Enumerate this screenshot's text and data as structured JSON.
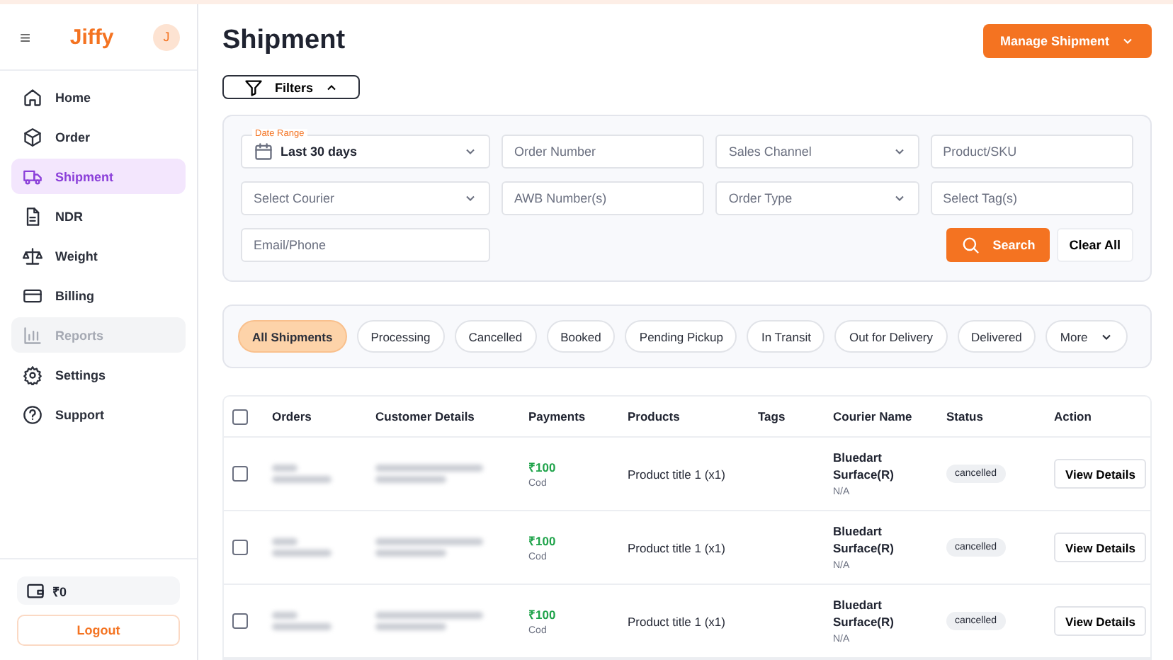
{
  "sidebar": {
    "menu_icon": "≡",
    "logo": "Jiffy",
    "avatar": "J",
    "items": [
      {
        "label": "Home",
        "selected": false,
        "disabled": false
      },
      {
        "label": "Order",
        "selected": false,
        "disabled": false
      },
      {
        "label": "Shipment",
        "selected": true,
        "disabled": false
      },
      {
        "label": "NDR",
        "selected": false,
        "disabled": false
      },
      {
        "label": "Weight",
        "selected": false,
        "disabled": false
      },
      {
        "label": "Billing",
        "selected": false,
        "disabled": false
      },
      {
        "label": "Reports",
        "selected": false,
        "disabled": true
      },
      {
        "label": "Settings",
        "selected": false,
        "disabled": false
      },
      {
        "label": "Support",
        "selected": false,
        "disabled": false
      }
    ],
    "wallet": "₹0",
    "logout": "Logout"
  },
  "page": {
    "title": "Shipment",
    "manage_button": "Manage Shipment",
    "filters_button": "Filters"
  },
  "filters": [
    {
      "kind": "date",
      "label": "Date Range",
      "value": "Last 30 days"
    },
    {
      "kind": "input",
      "placeholder": "Order Number"
    },
    {
      "kind": "select",
      "placeholder": "Sales Channel"
    },
    {
      "kind": "input",
      "placeholder": "Product/SKU"
    },
    {
      "kind": "select",
      "placeholder": "Select Courier"
    },
    {
      "kind": "input",
      "placeholder": "AWB Number(s)"
    },
    {
      "kind": "select",
      "placeholder": "Order Type"
    },
    {
      "kind": "input",
      "placeholder": "Select Tag(s)"
    },
    {
      "kind": "input",
      "placeholder": "Email/Phone"
    }
  ],
  "search_button": "Search",
  "clear_button": "Clear All",
  "status_tabs": [
    {
      "label": "All Shipments",
      "selected": true
    },
    {
      "label": "Processing",
      "selected": false
    },
    {
      "label": "Cancelled",
      "selected": false
    },
    {
      "label": "Booked",
      "selected": false
    },
    {
      "label": "Pending Pickup",
      "selected": false
    },
    {
      "label": "In Transit",
      "selected": false
    },
    {
      "label": "Out for Delivery",
      "selected": false
    },
    {
      "label": "Delivered",
      "selected": false
    },
    {
      "label": "More",
      "selected": false,
      "dropdown": true
    }
  ],
  "table": {
    "select_all_checked": false,
    "columns": [
      "Orders",
      "Customer Details",
      "Payments",
      "Products",
      "Tags",
      "Courier Name",
      "Status",
      "Action"
    ],
    "rows": [
      {
        "checked": false,
        "amount": "₹100",
        "mode": "Cod",
        "product": "Product title 1 (x1)",
        "courier": "Bluedart Surface(R)",
        "courier_note": "N/A",
        "status": "cancelled",
        "action": "View Details"
      },
      {
        "checked": false,
        "amount": "₹100",
        "mode": "Cod",
        "product": "Product title 1 (x1)",
        "courier": "Bluedart Surface(R)",
        "courier_note": "N/A",
        "status": "cancelled",
        "action": "View Details"
      },
      {
        "checked": false,
        "amount": "₹100",
        "mode": "Cod",
        "product": "Product title 1 (x1)",
        "courier": "Bluedart Surface(R)",
        "courier_note": "N/A",
        "status": "cancelled",
        "action": "View Details"
      }
    ]
  }
}
